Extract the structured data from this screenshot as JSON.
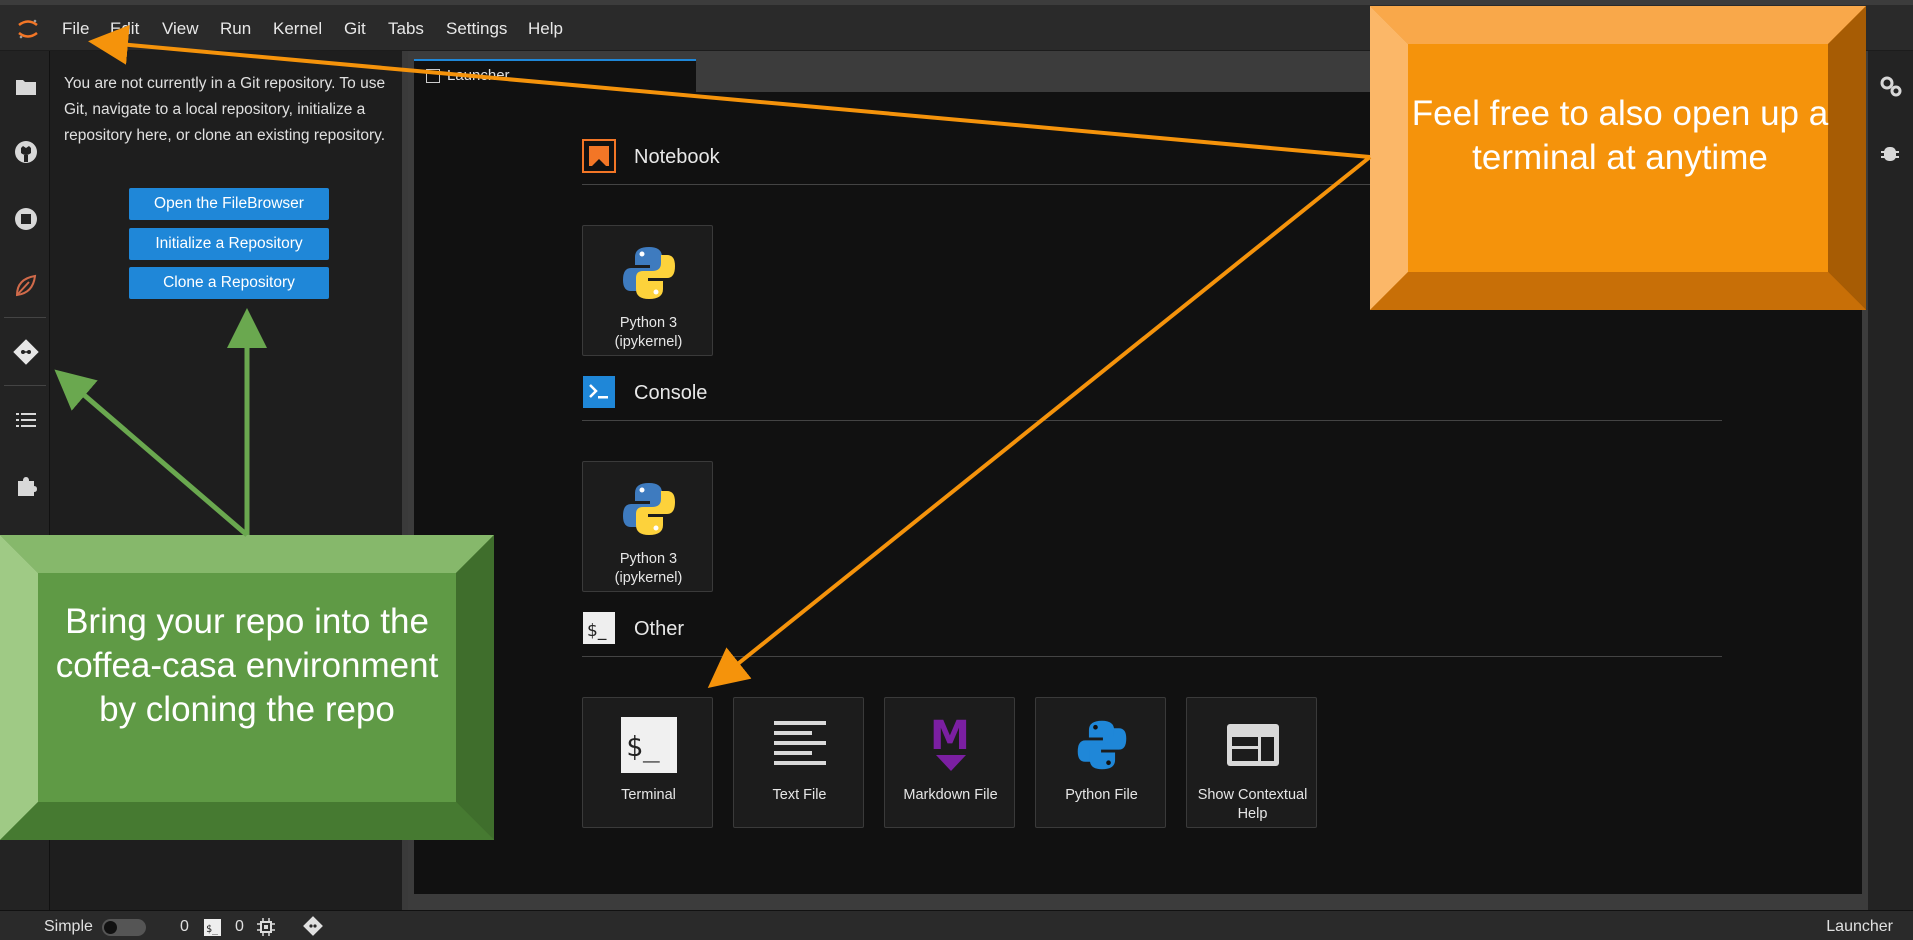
{
  "menu": {
    "items": [
      "File",
      "Edit",
      "View",
      "Run",
      "Kernel",
      "Git",
      "Tabs",
      "Settings",
      "Help"
    ]
  },
  "git_panel": {
    "message": "You are not currently in a Git repository. To use Git, navigate to a local repository, initialize a repository here, or clone an existing repository.",
    "buttons": [
      "Open the FileBrowser",
      "Initialize a Repository",
      "Clone a Repository"
    ]
  },
  "tabs": [
    {
      "label": "Launcher"
    }
  ],
  "launcher": {
    "sections": [
      {
        "label": "Notebook",
        "cards": [
          {
            "label": "Python 3\n(ipykernel)",
            "icon": "python-icon"
          }
        ]
      },
      {
        "label": "Console",
        "cards": [
          {
            "label": "Python 3\n(ipykernel)",
            "icon": "python-icon"
          }
        ]
      },
      {
        "label": "Other",
        "cards": [
          {
            "label": "Terminal",
            "icon": "terminal-icon"
          },
          {
            "label": "Text File",
            "icon": "text-file-icon"
          },
          {
            "label": "Markdown File",
            "icon": "markdown-icon"
          },
          {
            "label": "Python File",
            "icon": "python-icon"
          },
          {
            "label": "Show Contextual Help",
            "icon": "contextual-help-icon"
          }
        ]
      }
    ]
  },
  "statusbar": {
    "mode_label": "Simple",
    "terminal_count": "0",
    "kernel_count": "0",
    "right_label": "Launcher"
  },
  "callouts": {
    "orange": "Feel free to also open up a terminal at anytime",
    "green": "Bring your repo into the coffea-casa environment by cloning the repo"
  },
  "colors": {
    "accent": "#1f87d8",
    "callout_orange": "#f5930b",
    "callout_green": "#5f9a45",
    "arrow_orange": "#f5930b",
    "arrow_green": "#6aa84f"
  }
}
